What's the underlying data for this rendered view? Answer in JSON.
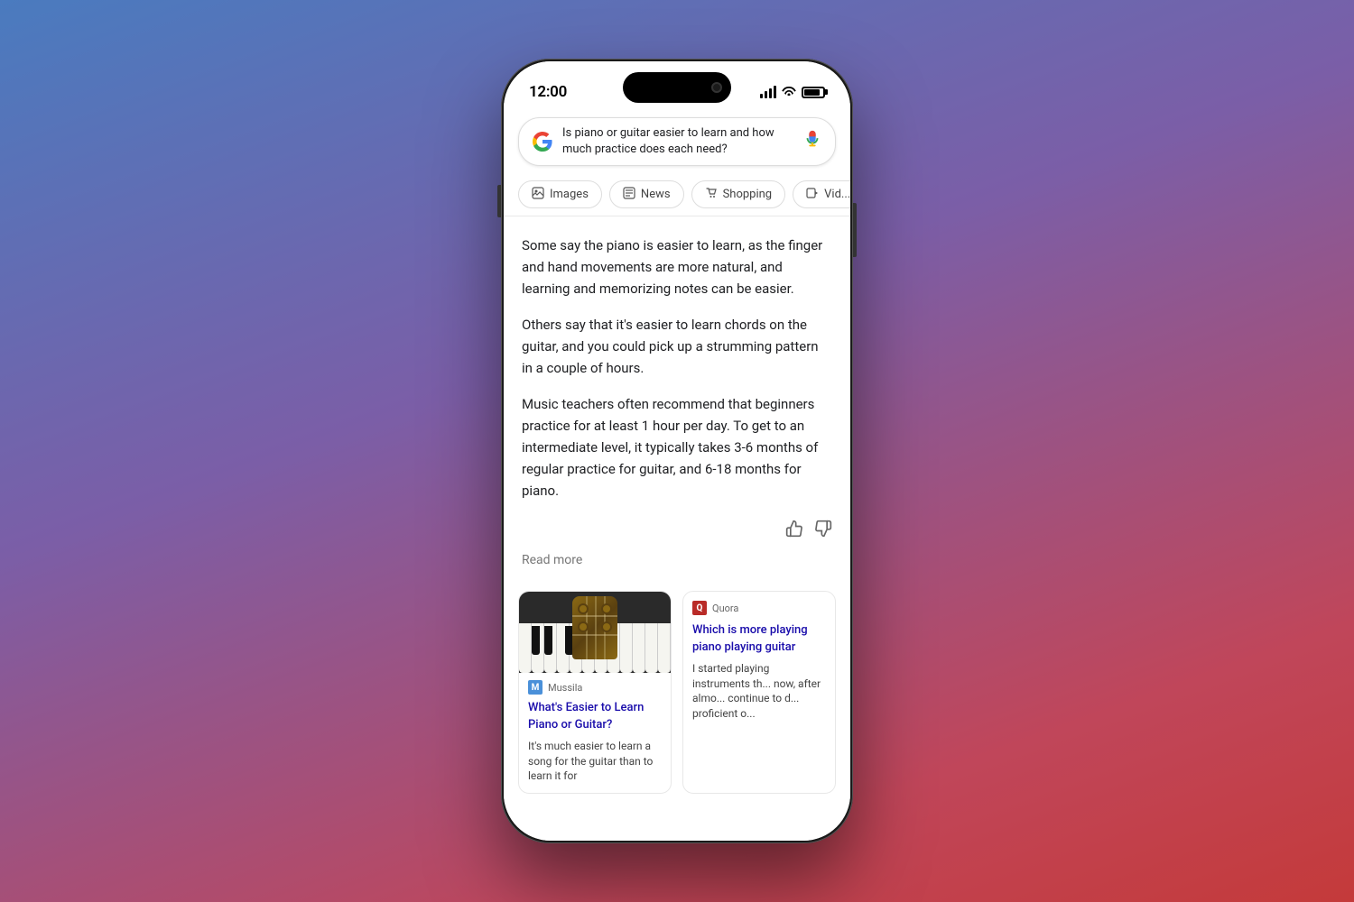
{
  "phone": {
    "time": "12:00",
    "search_query": "Is piano or guitar easier to learn and how much practice does each need?",
    "tabs": [
      {
        "id": "images",
        "label": "Images",
        "icon": "🖼"
      },
      {
        "id": "news",
        "label": "News",
        "icon": "📰"
      },
      {
        "id": "shopping",
        "label": "Shopping",
        "icon": "🛍"
      },
      {
        "id": "videos",
        "label": "Vid...",
        "icon": "▶"
      }
    ],
    "ai_answer": {
      "paragraph1": "Some say the piano is easier to learn, as the finger and hand movements are more natural, and learning and memorizing notes can be easier.",
      "paragraph2": "Others say that it's easier to learn chords on the guitar, and you could pick up a strumming pattern in a couple of hours.",
      "paragraph3": "Music teachers often recommend that beginners practice for at least 1 hour per day. To get to an intermediate level, it typically takes 3-6 months of regular practice for guitar, and 6-18 months for piano.",
      "read_more": "Read more"
    },
    "cards": [
      {
        "id": "mussila",
        "source": "Mussila",
        "title": "What's Easier to Learn Piano or Guitar?",
        "snippet": "It's much easier to learn a song for the guitar than to learn it for"
      },
      {
        "id": "quora",
        "source": "Quora",
        "title": "Which is more playing piano playing guitar",
        "snippet": "I started playing instruments th... now, after almo... continue to d... proficient o..."
      }
    ]
  }
}
